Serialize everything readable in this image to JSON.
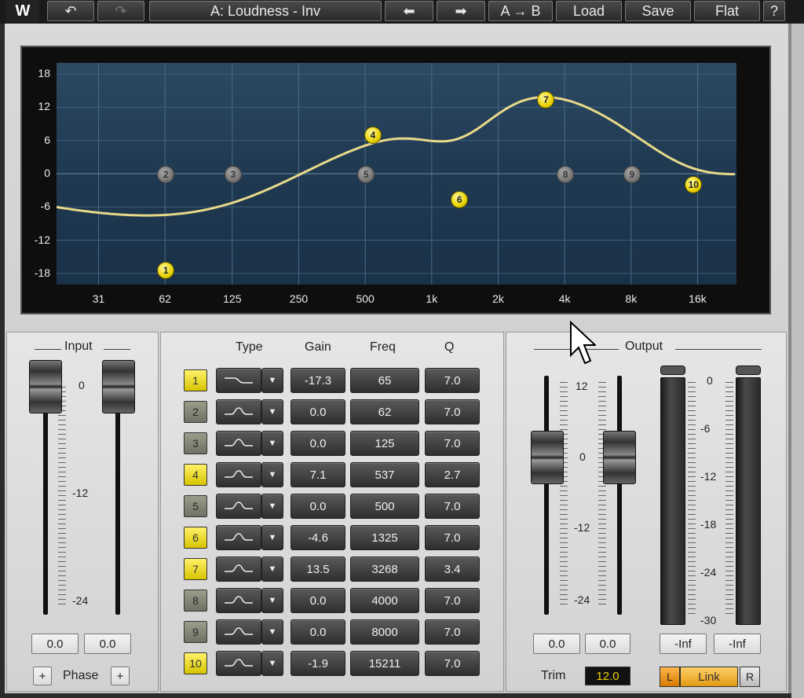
{
  "toolbar": {
    "logo": "W",
    "undo_icon": "↶",
    "redo_icon": "↷",
    "preset_name": "A: Loudness - Inv",
    "prev_icon": "⬅",
    "next_icon": "➡",
    "ab_label": "A → B",
    "load_label": "Load",
    "save_label": "Save",
    "flat_label": "Flat",
    "help_label": "?"
  },
  "graph": {
    "y_ticks": [
      "18",
      "12",
      "6",
      "0",
      "-6",
      "-12",
      "-18"
    ],
    "x_ticks": [
      "31",
      "62",
      "125",
      "250",
      "500",
      "1k",
      "2k",
      "4k",
      "8k",
      "16k"
    ],
    "nodes": [
      {
        "id": "1",
        "freq": 62,
        "gain": -17.3,
        "active": true
      },
      {
        "id": "2",
        "freq": 62,
        "gain": 0.0,
        "active": false
      },
      {
        "id": "3",
        "freq": 125,
        "gain": 0.0,
        "active": false
      },
      {
        "id": "4",
        "freq": 537,
        "gain": 7.1,
        "active": true
      },
      {
        "id": "5",
        "freq": 500,
        "gain": 0.0,
        "active": false
      },
      {
        "id": "6",
        "freq": 1325,
        "gain": -4.6,
        "active": true
      },
      {
        "id": "7",
        "freq": 3268,
        "gain": 13.5,
        "active": true
      },
      {
        "id": "8",
        "freq": 4000,
        "gain": 0.0,
        "active": false
      },
      {
        "id": "9",
        "freq": 8000,
        "gain": 0.0,
        "active": false
      },
      {
        "id": "10",
        "freq": 15211,
        "gain": -1.9,
        "active": true
      }
    ],
    "curve_color": "#e8d98a"
  },
  "input": {
    "title": "Input",
    "ticks": [
      "0",
      "-12",
      "-24"
    ],
    "left_value": "0.0",
    "right_value": "0.0",
    "phase_label": "Phase",
    "phase_left_icon": "+",
    "phase_right_icon": "+"
  },
  "bands": {
    "headers": {
      "type": "Type",
      "gain": "Gain",
      "freq": "Freq",
      "q": "Q"
    },
    "dropdown_icon": "▼",
    "rows": [
      {
        "num": "1",
        "active": true,
        "gain": "-17.3",
        "freq": "65",
        "q": "7.0",
        "shape": "lowshelf"
      },
      {
        "num": "2",
        "active": false,
        "gain": "0.0",
        "freq": "62",
        "q": "7.0",
        "shape": "bell"
      },
      {
        "num": "3",
        "active": false,
        "gain": "0.0",
        "freq": "125",
        "q": "7.0",
        "shape": "bell"
      },
      {
        "num": "4",
        "active": true,
        "gain": "7.1",
        "freq": "537",
        "q": "2.7",
        "shape": "bell"
      },
      {
        "num": "5",
        "active": false,
        "gain": "0.0",
        "freq": "500",
        "q": "7.0",
        "shape": "bell"
      },
      {
        "num": "6",
        "active": true,
        "gain": "-4.6",
        "freq": "1325",
        "q": "7.0",
        "shape": "bell"
      },
      {
        "num": "7",
        "active": true,
        "gain": "13.5",
        "freq": "3268",
        "q": "3.4",
        "shape": "bell"
      },
      {
        "num": "8",
        "active": false,
        "gain": "0.0",
        "freq": "4000",
        "q": "7.0",
        "shape": "bell"
      },
      {
        "num": "9",
        "active": false,
        "gain": "0.0",
        "freq": "8000",
        "q": "7.0",
        "shape": "bell"
      },
      {
        "num": "10",
        "active": true,
        "gain": "-1.9",
        "freq": "15211",
        "q": "7.0",
        "shape": "bell"
      }
    ]
  },
  "output": {
    "title": "Output",
    "fader_ticks": [
      "12",
      "0",
      "-12",
      "-24"
    ],
    "meter_ticks": [
      "0",
      "-6",
      "-12",
      "-18",
      "-24",
      "-30"
    ],
    "left_value": "0.0",
    "right_value": "0.0",
    "left_peak": "-Inf",
    "right_peak": "-Inf",
    "trim_label": "Trim",
    "trim_value": "12.0",
    "l_label": "L",
    "link_label": "Link",
    "r_label": "R"
  }
}
